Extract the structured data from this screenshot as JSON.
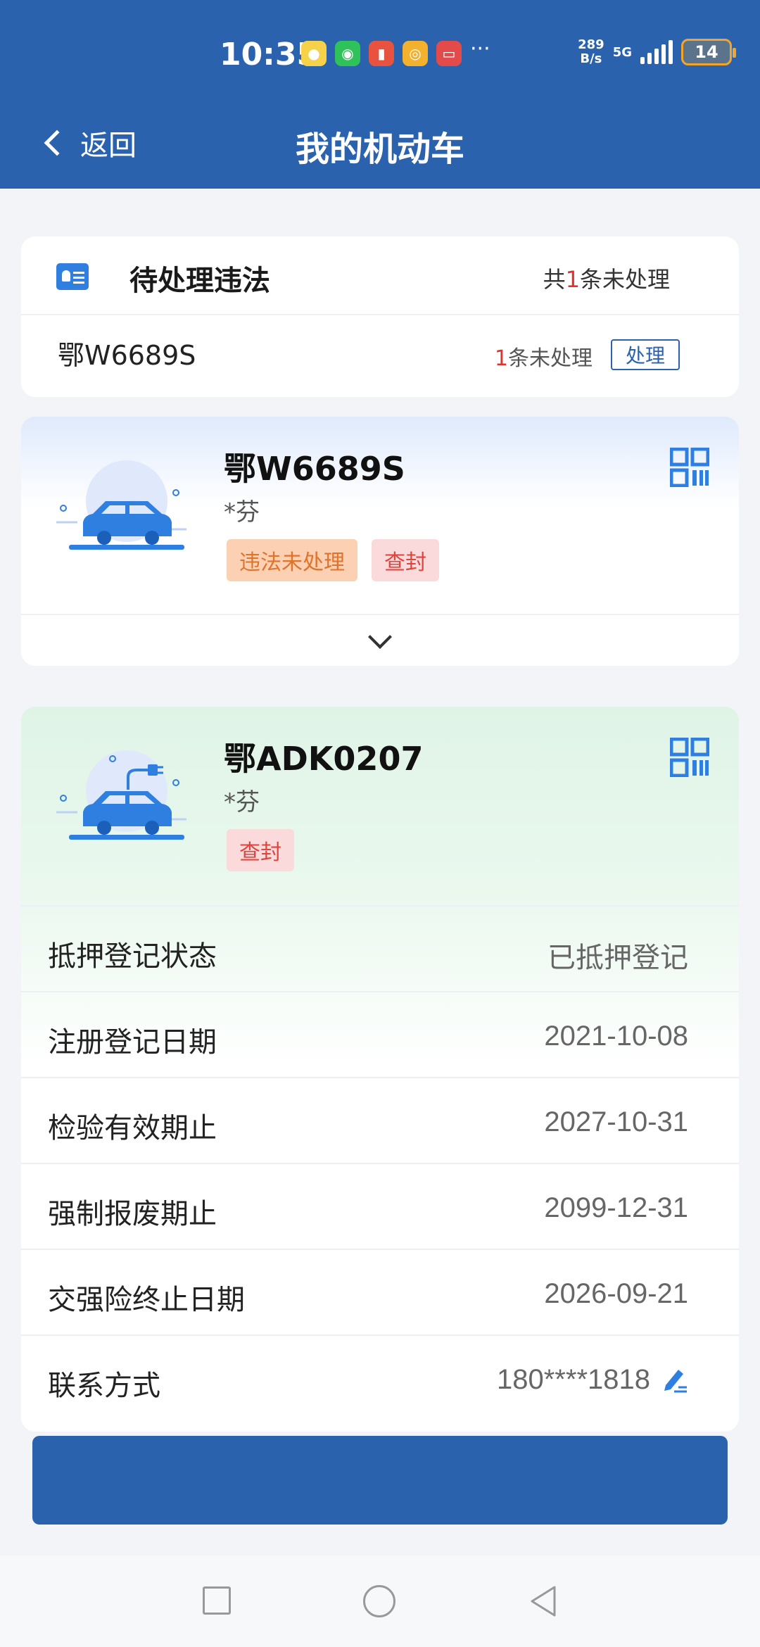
{
  "status_bar": {
    "time": "10:35",
    "net_speed_value": "289",
    "net_speed_unit": "B/s",
    "network": "5G",
    "battery": "14",
    "more": "···"
  },
  "nav": {
    "back_label": "返回",
    "title": "我的机动车"
  },
  "violations": {
    "title": "待处理违法",
    "total_prefix": "共",
    "total_count": "1",
    "total_suffix": "条未处理",
    "item": {
      "plate": "鄂W6689S",
      "count": "1",
      "count_suffix": "条未处理",
      "action_label": "处理"
    }
  },
  "vehicles": [
    {
      "plate": "鄂W6689S",
      "owner": "*芬",
      "tags": [
        "违法未处理",
        "查封"
      ]
    },
    {
      "plate": "鄂ADK0207",
      "owner": "*芬",
      "tags": [
        "查封"
      ],
      "details": [
        {
          "label": "抵押登记状态",
          "value": "已抵押登记"
        },
        {
          "label": "注册登记日期",
          "value": "2021-10-08"
        },
        {
          "label": "检验有效期止",
          "value": "2027-10-31"
        },
        {
          "label": "强制报废期止",
          "value": "2099-12-31"
        },
        {
          "label": "交强险终止日期",
          "value": "2026-09-21"
        },
        {
          "label": "联系方式",
          "value": "180****1818"
        }
      ]
    }
  ],
  "colors": {
    "primary": "#2b62ad",
    "accent_red": "#e1322b",
    "tag_orange_bg": "#fcd0b3",
    "tag_red_bg": "#fadadb",
    "icon_blue": "#2e7fe0"
  }
}
